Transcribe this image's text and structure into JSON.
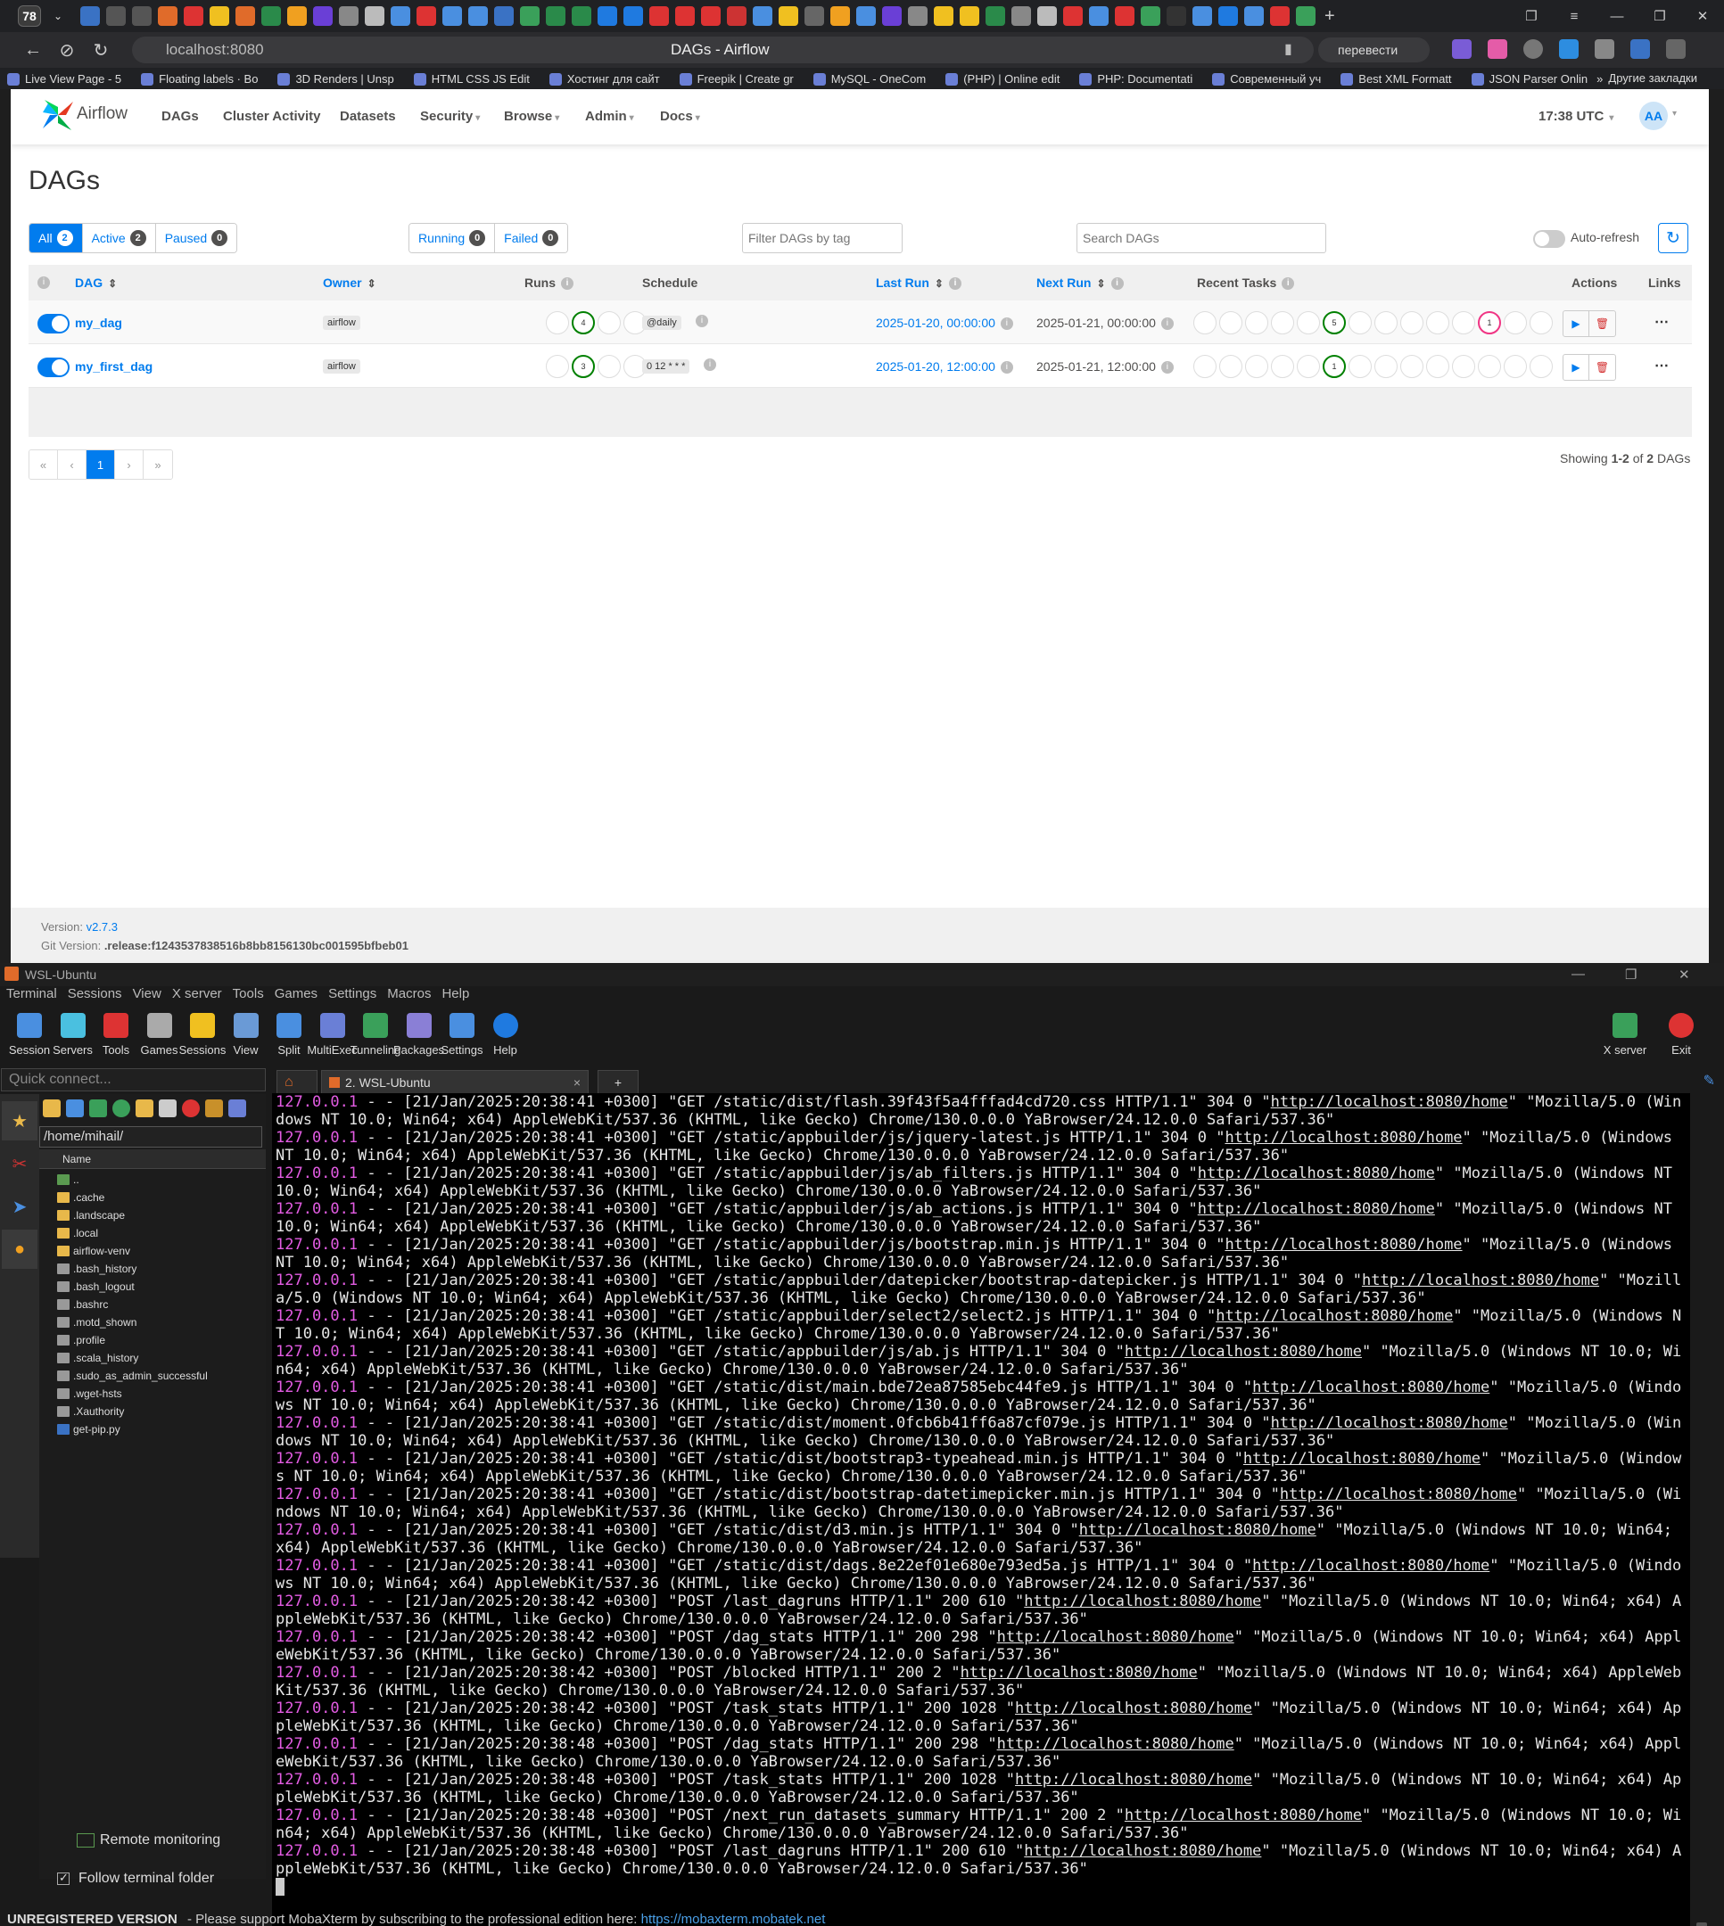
{
  "browser": {
    "tab_count": "78",
    "url": "localhost:8080",
    "page_title": "DAGs - Airflow",
    "translate_label": "перевести",
    "bookmarks": [
      "Live View Page - 5",
      "Floating labels · Bo",
      "3D Renders | Unsp",
      "HTML CSS JS Edit",
      "Хостинг для сайт",
      "Freepik | Create gr",
      "MySQL - OneCom",
      "(PHP) | Online edit",
      "PHP: Documentati",
      "Современный уч",
      "Best XML Formatt",
      "JSON Parser Onlin"
    ],
    "bookmarks_more": "»",
    "other_bookmarks": "Другие закладки"
  },
  "airflow": {
    "brand": "Airflow",
    "nav": [
      {
        "label": "DAGs"
      },
      {
        "label": "Cluster Activity"
      },
      {
        "label": "Datasets"
      },
      {
        "label": "Security"
      },
      {
        "label": "Browse"
      },
      {
        "label": "Admin"
      },
      {
        "label": "Docs"
      }
    ],
    "time": "17:38 UTC",
    "avatar": "AA",
    "heading": "DAGs",
    "filters": {
      "all": {
        "label": "All",
        "count": "2"
      },
      "active": {
        "label": "Active",
        "count": "2"
      },
      "paused": {
        "label": "Paused",
        "count": "0"
      },
      "running": {
        "label": "Running",
        "count": "0"
      },
      "failed": {
        "label": "Failed",
        "count": "0"
      }
    },
    "tag_filter_placeholder": "Filter DAGs by tag",
    "search_placeholder": "Search DAGs",
    "auto_refresh": "Auto-refresh",
    "columns": {
      "dag": "DAG",
      "owner": "Owner",
      "runs": "Runs",
      "schedule": "Schedule",
      "last_run": "Last Run",
      "next_run": "Next Run",
      "recent_tasks": "Recent Tasks",
      "actions": "Actions",
      "links": "Links"
    },
    "rows": [
      {
        "dag_id": "my_dag",
        "owner": "airflow",
        "runs": [
          "",
          "4",
          "",
          ""
        ],
        "schedule": "@daily",
        "last_run": "2025-01-20, 00:00:00",
        "next_run": "2025-01-21, 00:00:00",
        "tasks": [
          "",
          "",
          "",
          "",
          "",
          "5",
          "",
          "",
          "",
          "",
          "",
          "1",
          "",
          ""
        ]
      },
      {
        "dag_id": "my_first_dag",
        "owner": "airflow",
        "runs": [
          "",
          "3",
          "",
          ""
        ],
        "schedule": "0 12 * * *",
        "last_run": "2025-01-20, 12:00:00",
        "next_run": "2025-01-21, 12:00:00",
        "tasks": [
          "",
          "",
          "",
          "",
          "",
          "1",
          "",
          "",
          "",
          "",
          "",
          "",
          "",
          ""
        ]
      }
    ],
    "pagination": [
      "«",
      "‹",
      "1",
      "›",
      "»"
    ],
    "showing_prefix": "Showing ",
    "showing_range": "1-2",
    "showing_mid": " of ",
    "showing_total": "2",
    "showing_suffix": " DAGs",
    "version_label": "Version: ",
    "version": "v2.7.3",
    "git_label": "Git Version: ",
    "git_version": ".release:f1243537838516b8bb8156130bc001595bfbeb01"
  },
  "moba": {
    "title": "WSL-Ubuntu",
    "menu": [
      "Terminal",
      "Sessions",
      "View",
      "X server",
      "Tools",
      "Games",
      "Settings",
      "Macros",
      "Help"
    ],
    "toolbar": [
      "Session",
      "Servers",
      "Tools",
      "Games",
      "Sessions",
      "View",
      "Split",
      "MultiExec",
      "Tunneling",
      "Packages",
      "Settings",
      "Help"
    ],
    "toolbar_right": [
      "X server",
      "Exit"
    ],
    "quick_connect": "Quick connect...",
    "path": "/home/mihail/",
    "name_col": "Name",
    "files": [
      "..",
      ".cache",
      ".landscape",
      ".local",
      "airflow-venv",
      ".bash_history",
      ".bash_logout",
      ".bashrc",
      ".motd_shown",
      ".profile",
      ".scala_history",
      ".sudo_as_admin_successful",
      ".wget-hsts",
      ".Xauthority",
      "get-pip.py"
    ],
    "remote_monitoring": "Remote monitoring",
    "follow_folder": "Follow terminal folder",
    "term_tab": "2. WSL-Ubuntu",
    "log": [
      {
        "ip": "127.0.0.1",
        "pre": " - - [21/Jan/2025:20:38:41 +0300] \"GET /static/dist/flash.39f43f5a4fffad4cd720.css HTTP/1.1\" 304 0 \"",
        "url": "http://localhost:8080/home",
        "post": "\" \"Mozilla/5.0 (Windows NT 10.0; Win64; x64) AppleWebKit/537.36 (KHTML, like Gecko) Chrome/130.0.0.0 YaBrowser/24.12.0.0 Safari/537.36\""
      },
      {
        "ip": "127.0.0.1",
        "pre": " - - [21/Jan/2025:20:38:41 +0300] \"GET /static/appbuilder/js/jquery-latest.js HTTP/1.1\" 304 0 \"",
        "url": "http://localhost:8080/home",
        "post": "\" \"Mozilla/5.0 (Windows NT 10.0; Win64; x64) AppleWebKit/537.36 (KHTML, like Gecko) Chrome/130.0.0.0 YaBrowser/24.12.0.0 Safari/537.36\""
      },
      {
        "ip": "127.0.0.1",
        "pre": " - - [21/Jan/2025:20:38:41 +0300] \"GET /static/appbuilder/js/ab_filters.js HTTP/1.1\" 304 0 \"",
        "url": "http://localhost:8080/home",
        "post": "\" \"Mozilla/5.0 (Windows NT 10.0; Win64; x64) AppleWebKit/537.36 (KHTML, like Gecko) Chrome/130.0.0.0 YaBrowser/24.12.0.0 Safari/537.36\""
      },
      {
        "ip": "127.0.0.1",
        "pre": " - - [21/Jan/2025:20:38:41 +0300] \"GET /static/appbuilder/js/ab_actions.js HTTP/1.1\" 304 0 \"",
        "url": "http://localhost:8080/home",
        "post": "\" \"Mozilla/5.0 (Windows NT 10.0; Win64; x64) AppleWebKit/537.36 (KHTML, like Gecko) Chrome/130.0.0.0 YaBrowser/24.12.0.0 Safari/537.36\""
      },
      {
        "ip": "127.0.0.1",
        "pre": " - - [21/Jan/2025:20:38:41 +0300] \"GET /static/appbuilder/js/bootstrap.min.js HTTP/1.1\" 304 0 \"",
        "url": "http://localhost:8080/home",
        "post": "\" \"Mozilla/5.0 (Windows NT 10.0; Win64; x64) AppleWebKit/537.36 (KHTML, like Gecko) Chrome/130.0.0.0 YaBrowser/24.12.0.0 Safari/537.36\""
      },
      {
        "ip": "127.0.0.1",
        "pre": " - - [21/Jan/2025:20:38:41 +0300] \"GET /static/appbuilder/datepicker/bootstrap-datepicker.js HTTP/1.1\" 304 0 \"",
        "url": "http://localhost:8080/home",
        "post": "\" \"Mozilla/5.0 (Windows NT 10.0; Win64; x64) AppleWebKit/537.36 (KHTML, like Gecko) Chrome/130.0.0.0 YaBrowser/24.12.0.0 Safari/537.36\""
      },
      {
        "ip": "127.0.0.1",
        "pre": " - - [21/Jan/2025:20:38:41 +0300] \"GET /static/appbuilder/select2/select2.js HTTP/1.1\" 304 0 \"",
        "url": "http://localhost:8080/home",
        "post": "\" \"Mozilla/5.0 (Windows NT 10.0; Win64; x64) AppleWebKit/537.36 (KHTML, like Gecko) Chrome/130.0.0.0 YaBrowser/24.12.0.0 Safari/537.36\""
      },
      {
        "ip": "127.0.0.1",
        "pre": " - - [21/Jan/2025:20:38:41 +0300] \"GET /static/appbuilder/js/ab.js HTTP/1.1\" 304 0 \"",
        "url": "http://localhost:8080/home",
        "post": "\" \"Mozilla/5.0 (Windows NT 10.0; Win64; x64) AppleWebKit/537.36 (KHTML, like Gecko) Chrome/130.0.0.0 YaBrowser/24.12.0.0 Safari/537.36\""
      },
      {
        "ip": "127.0.0.1",
        "pre": " - - [21/Jan/2025:20:38:41 +0300] \"GET /static/dist/main.bde72ea87585ebc44fe9.js HTTP/1.1\" 304 0 \"",
        "url": "http://localhost:8080/home",
        "post": "\" \"Mozilla/5.0 (Windows NT 10.0; Win64; x64) AppleWebKit/537.36 (KHTML, like Gecko) Chrome/130.0.0.0 YaBrowser/24.12.0.0 Safari/537.36\""
      },
      {
        "ip": "127.0.0.1",
        "pre": " - - [21/Jan/2025:20:38:41 +0300] \"GET /static/dist/moment.0fcb6b41ff6a87cf079e.js HTTP/1.1\" 304 0 \"",
        "url": "http://localhost:8080/home",
        "post": "\" \"Mozilla/5.0 (Windows NT 10.0; Win64; x64) AppleWebKit/537.36 (KHTML, like Gecko) Chrome/130.0.0.0 YaBrowser/24.12.0.0 Safari/537.36\""
      },
      {
        "ip": "127.0.0.1",
        "pre": " - - [21/Jan/2025:20:38:41 +0300] \"GET /static/dist/bootstrap3-typeahead.min.js HTTP/1.1\" 304 0 \"",
        "url": "http://localhost:8080/home",
        "post": "\" \"Mozilla/5.0 (Windows NT 10.0; Win64; x64) AppleWebKit/537.36 (KHTML, like Gecko) Chrome/130.0.0.0 YaBrowser/24.12.0.0 Safari/537.36\""
      },
      {
        "ip": "127.0.0.1",
        "pre": " - - [21/Jan/2025:20:38:41 +0300] \"GET /static/dist/bootstrap-datetimepicker.min.js HTTP/1.1\" 304 0 \"",
        "url": "http://localhost:8080/home",
        "post": "\" \"Mozilla/5.0 (Windows NT 10.0; Win64; x64) AppleWebKit/537.36 (KHTML, like Gecko) Chrome/130.0.0.0 YaBrowser/24.12.0.0 Safari/537.36\""
      },
      {
        "ip": "127.0.0.1",
        "pre": " - - [21/Jan/2025:20:38:41 +0300] \"GET /static/dist/d3.min.js HTTP/1.1\" 304 0 \"",
        "url": "http://localhost:8080/home",
        "post": "\" \"Mozilla/5.0 (Windows NT 10.0; Win64; x64) AppleWebKit/537.36 (KHTML, like Gecko) Chrome/130.0.0.0 YaBrowser/24.12.0.0 Safari/537.36\""
      },
      {
        "ip": "127.0.0.1",
        "pre": " - - [21/Jan/2025:20:38:41 +0300] \"GET /static/dist/dags.8e22ef01e680e793ed5a.js HTTP/1.1\" 304 0 \"",
        "url": "http://localhost:8080/home",
        "post": "\" \"Mozilla/5.0 (Windows NT 10.0; Win64; x64) AppleWebKit/537.36 (KHTML, like Gecko) Chrome/130.0.0.0 YaBrowser/24.12.0.0 Safari/537.36\""
      },
      {
        "ip": "127.0.0.1",
        "pre": " - - [21/Jan/2025:20:38:42 +0300] \"POST /last_dagruns HTTP/1.1\" 200 610 \"",
        "url": "http://localhost:8080/home",
        "post": "\" \"Mozilla/5.0 (Windows NT 10.0; Win64; x64) AppleWebKit/537.36 (KHTML, like Gecko) Chrome/130.0.0.0 YaBrowser/24.12.0.0 Safari/537.36\""
      },
      {
        "ip": "127.0.0.1",
        "pre": " - - [21/Jan/2025:20:38:42 +0300] \"POST /dag_stats HTTP/1.1\" 200 298 \"",
        "url": "http://localhost:8080/home",
        "post": "\" \"Mozilla/5.0 (Windows NT 10.0; Win64; x64) AppleWebKit/537.36 (KHTML, like Gecko) Chrome/130.0.0.0 YaBrowser/24.12.0.0 Safari/537.36\""
      },
      {
        "ip": "127.0.0.1",
        "pre": " - - [21/Jan/2025:20:38:42 +0300] \"POST /blocked HTTP/1.1\" 200 2 \"",
        "url": "http://localhost:8080/home",
        "post": "\" \"Mozilla/5.0 (Windows NT 10.0; Win64; x64) AppleWebKit/537.36 (KHTML, like Gecko) Chrome/130.0.0.0 YaBrowser/24.12.0.0 Safari/537.36\""
      },
      {
        "ip": "127.0.0.1",
        "pre": " - - [21/Jan/2025:20:38:42 +0300] \"POST /task_stats HTTP/1.1\" 200 1028 \"",
        "url": "http://localhost:8080/home",
        "post": "\" \"Mozilla/5.0 (Windows NT 10.0; Win64; x64) AppleWebKit/537.36 (KHTML, like Gecko) Chrome/130.0.0.0 YaBrowser/24.12.0.0 Safari/537.36\""
      },
      {
        "ip": "127.0.0.1",
        "pre": " - - [21/Jan/2025:20:38:48 +0300] \"POST /dag_stats HTTP/1.1\" 200 298 \"",
        "url": "http://localhost:8080/home",
        "post": "\" \"Mozilla/5.0 (Windows NT 10.0; Win64; x64) AppleWebKit/537.36 (KHTML, like Gecko) Chrome/130.0.0.0 YaBrowser/24.12.0.0 Safari/537.36\""
      },
      {
        "ip": "127.0.0.1",
        "pre": " - - [21/Jan/2025:20:38:48 +0300] \"POST /task_stats HTTP/1.1\" 200 1028 \"",
        "url": "http://localhost:8080/home",
        "post": "\" \"Mozilla/5.0 (Windows NT 10.0; Win64; x64) AppleWebKit/537.36 (KHTML, like Gecko) Chrome/130.0.0.0 YaBrowser/24.12.0.0 Safari/537.36\""
      },
      {
        "ip": "127.0.0.1",
        "pre": " - - [21/Jan/2025:20:38:48 +0300] \"POST /next_run_datasets_summary HTTP/1.1\" 200 2 \"",
        "url": "http://localhost:8080/home",
        "post": "\" \"Mozilla/5.0 (Windows NT 10.0; Win64; x64) AppleWebKit/537.36 (KHTML, like Gecko) Chrome/130.0.0.0 YaBrowser/24.12.0.0 Safari/537.36\""
      },
      {
        "ip": "127.0.0.1",
        "pre": " - - [21/Jan/2025:20:38:48 +0300] \"POST /last_dagruns HTTP/1.1\" 200 610 \"",
        "url": "http://localhost:8080/home",
        "post": "\" \"Mozilla/5.0 (Windows NT 10.0; Win64; x64) AppleWebKit/537.36 (KHTML, like Gecko) Chrome/130.0.0.0 YaBrowser/24.12.0.0 Safari/537.36\""
      }
    ],
    "status_unregistered": "UNREGISTERED VERSION",
    "status_message": "  -  Please support MobaXterm by subscribing to the professional edition here:  ",
    "status_link": "https://mobaxterm.mobatek.net"
  },
  "colors": {
    "airflow_blue": "#017cee",
    "success": "#008000",
    "failed": "#f03584",
    "terminal_ip": "#e35ce3"
  }
}
